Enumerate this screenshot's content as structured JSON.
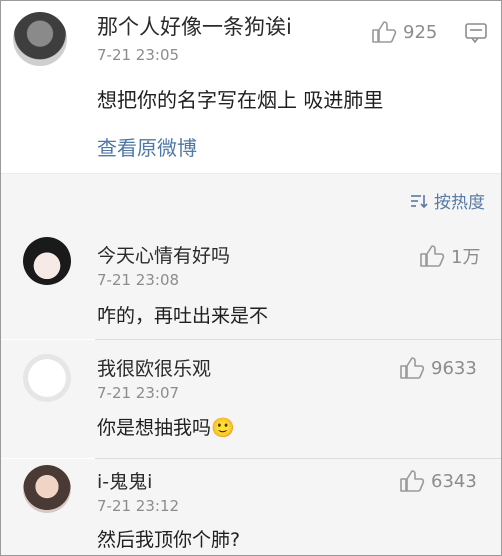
{
  "main_post": {
    "username": "那个人好像一条狗诶i",
    "time": "7-21 23:05",
    "text": "想把你的名字写在烟上  吸进肺里",
    "likes": "925",
    "view_original": "查看原微博"
  },
  "sort": {
    "label": "按热度"
  },
  "comments": [
    {
      "username": "今天心情有好吗",
      "time": "7-21 23:08",
      "text": "咋的，再吐出来是不",
      "likes": "1万"
    },
    {
      "username": "我很欧很乐观",
      "time": "7-21 23:07",
      "text": "你是想抽我吗🙂",
      "likes": "9633"
    },
    {
      "username": "i-鬼鬼i",
      "time": "7-21 23:12",
      "text": "然后我顶你个肺?",
      "likes": "6343"
    }
  ],
  "colors": {
    "link": "#4f79a7",
    "muted": "#8c8c8c",
    "bg_comments": "#f5f5f5"
  },
  "icons": [
    "thumb-up-icon",
    "comment-box-icon",
    "sort-icon"
  ]
}
